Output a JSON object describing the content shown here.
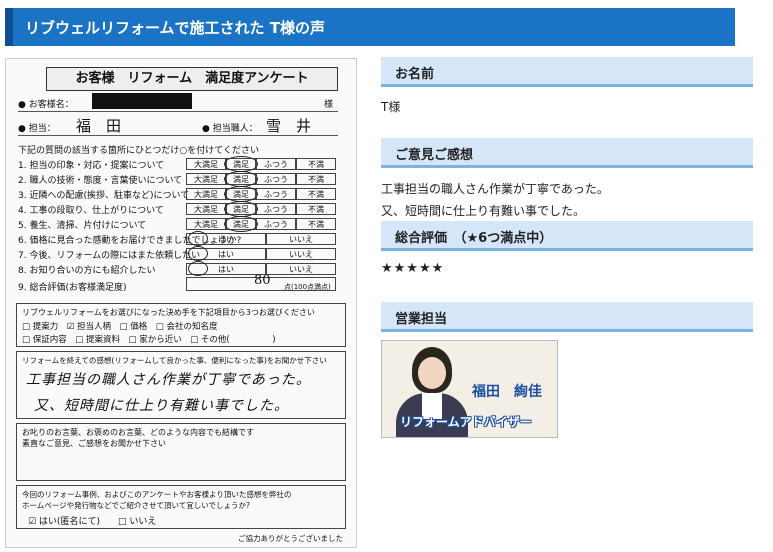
{
  "header": {
    "title": "リブウェルリフォームで施工された T様の声"
  },
  "survey": {
    "title": "お客様　リフォーム　満足度アンケート",
    "customer_label": "● お客様名：",
    "honorific": "様",
    "staff_label": "● 担当：",
    "staff_value": "福　田",
    "craftsman_label": "● 担当職人：",
    "craftsman_value": "雪　井",
    "instructions": "下記の質問の該当する箇所にひとつだけ○を付けてください",
    "questions": [
      "1. 担当の印象・対応・提案について",
      "2. 職人の技術・態度・言葉使いについて",
      "3. 近隣への配慮(挨拶、駐車など)について",
      "4. 工事の段取り、仕上がりについて",
      "5. 養生、清掃、片付けについて",
      "6. 価格に見合った感動をお届けできましたでしょうか?",
      "7. 今後、リフォームの際にはまた依頼したい",
      "8. お知り合いの方にも紹介したい",
      "9. 総合評価(お客様満足度)"
    ],
    "rating_options": [
      "大満足",
      "満足",
      "ふつう",
      "不満"
    ],
    "yes_label": "はい",
    "no_label": "いいえ",
    "score": "80",
    "score_unit": "点(100点満点)",
    "reason_prompt": "リブウェルリフォームをお選びになった決め手を下記項目から3つお選びください",
    "reason_row1": "□ 提案力　☑ 担当人柄　□ 価格　□ 会社の知名度",
    "reason_row2": "□ 保証内容　□ 提案資料　□ 家から近い　□ その他(　　　　　)",
    "impression_prompt": "リフォームを終えての感想(リフォームして良かった事、便利になった事)をお聞かせ下さい",
    "impression_line1": "工事担当の職人さん作業が丁寧であった。",
    "impression_line2": "又、短時間に仕上り有難い事でした。",
    "feedback_prompt1": "お叱りのお言葉、お褒めのお言葉、どのような内容でも結構です",
    "feedback_prompt2": "素直なご意見、ご感想をお聞かせ下さい",
    "permission_prompt1": "今回のリフォーム事例、およびこのアンケートやお客様より頂いた感想を弊社の",
    "permission_prompt2": "ホームページや発行物などでご紹介させて頂いて宜しいでしょうか?",
    "permission_options": "☑ はい(匿名にて)　　□ いいえ",
    "thanks": "ご協力ありがとうございました"
  },
  "name_section": {
    "heading": "お名前",
    "value": "T様"
  },
  "opinion_section": {
    "heading": "ご意見ご感想",
    "line1": "工事担当の職人さん作業が丁寧であった。",
    "line2": "又、短時間に仕上り有難い事でした。"
  },
  "rating_section": {
    "heading": "総合評価　（★6つ満点中）",
    "stars": "★★★★★",
    "rating": 5,
    "max": 6
  },
  "sales_section": {
    "heading": "営業担当",
    "person_name": "福田　絢佳",
    "person_role": "リフォームアドバイザー"
  },
  "colors": {
    "title_bg": "#1a73c4",
    "section_bg": "#d4e6f7",
    "section_border": "#7fb2e0",
    "name_color": "#1a4fa0"
  }
}
